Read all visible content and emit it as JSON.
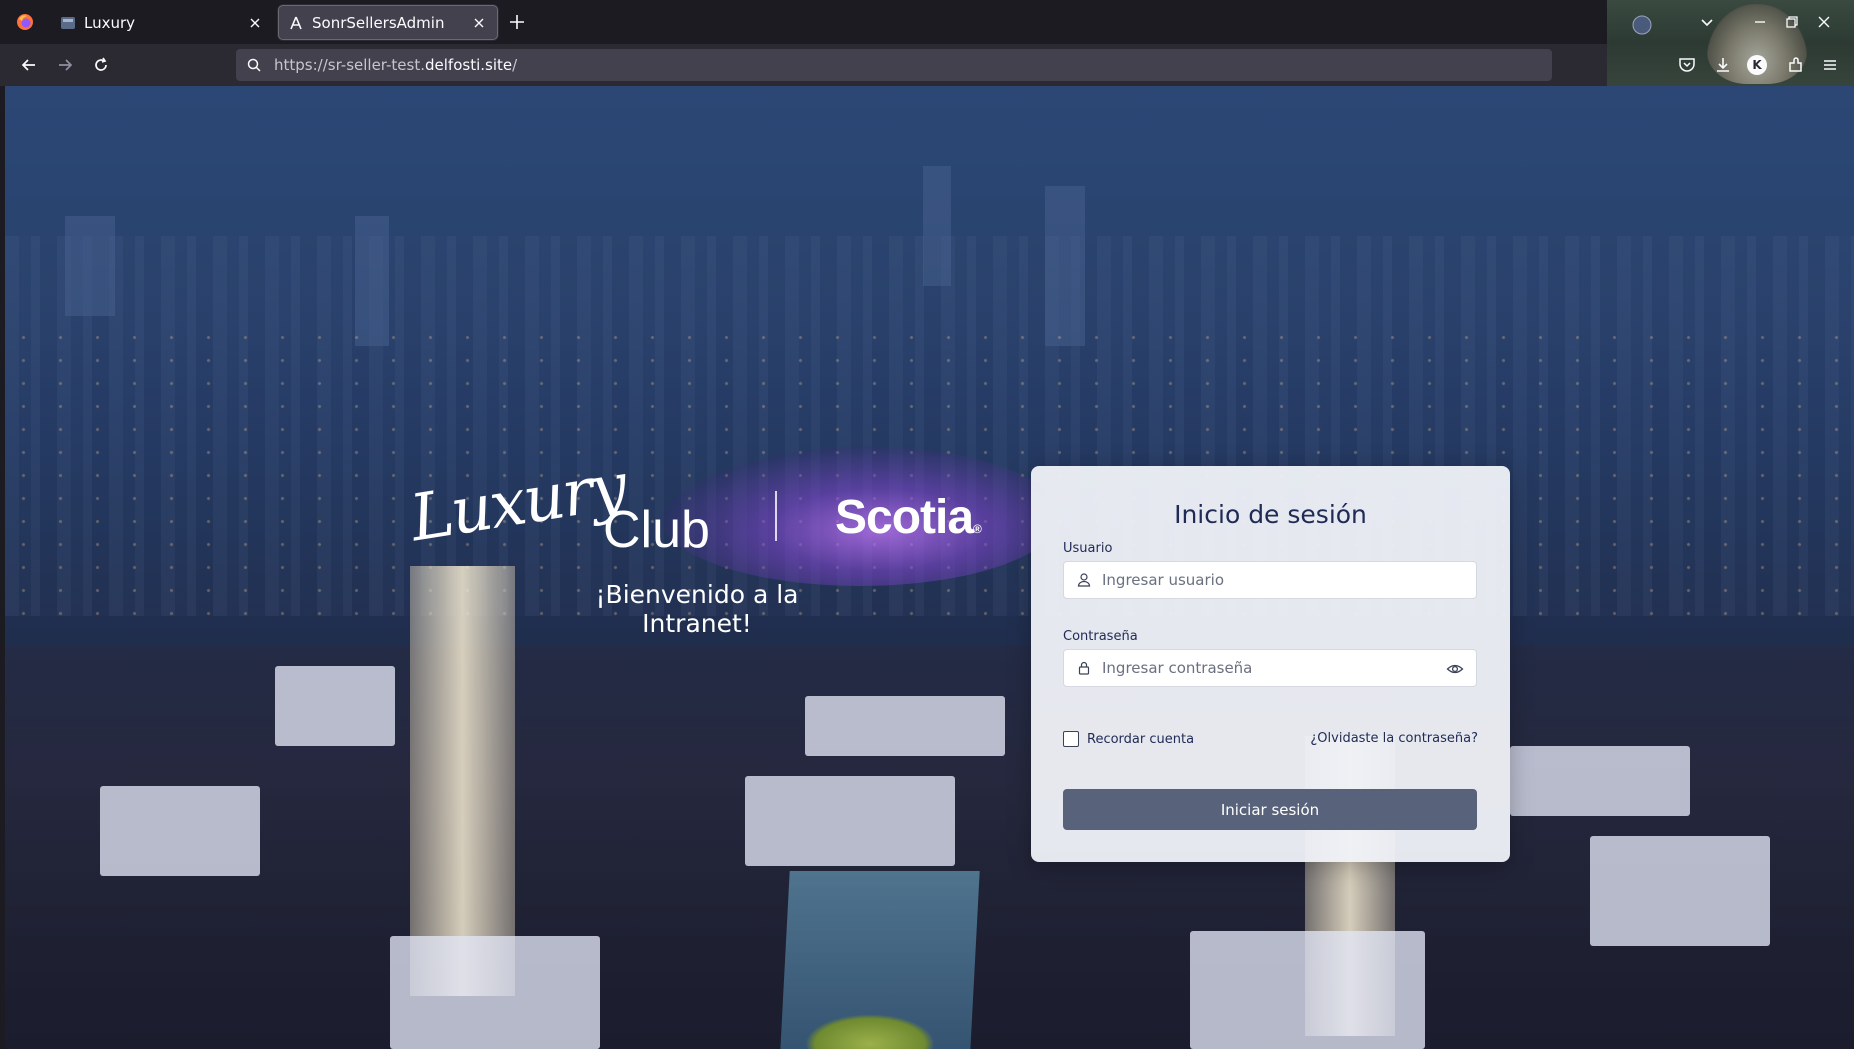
{
  "browser": {
    "tabs": [
      {
        "title": "Luxury",
        "active": false
      },
      {
        "title": "SonrSellersAdmin",
        "active": true
      }
    ],
    "url_prefix": "https://sr-seller-test.",
    "url_host": "delfosti.site",
    "url_suffix": "/",
    "profile_initial": "K",
    "icons": [
      "firefox-logo",
      "back-arrow",
      "forward-arrow",
      "reload",
      "search",
      "pocket",
      "downloads",
      "extensions",
      "menu"
    ]
  },
  "branding": {
    "luxury_script": "Luxury",
    "club": "Club",
    "scotia": "Scotia",
    "scotia_mark": "®",
    "welcome": "¡Bienvenido a la Intranet!"
  },
  "login": {
    "title": "Inicio de sesión",
    "username_label": "Usuario",
    "username_placeholder": "Ingresar usuario",
    "password_label": "Contraseña",
    "password_placeholder": "Ingresar contraseña",
    "remember_label": "Recordar cuenta",
    "forgot_link": "¿Olvidaste la contraseña?",
    "submit_label": "Iniciar sesión"
  },
  "colors": {
    "card_bg": "#f0f2f8",
    "title": "#1f2a55",
    "button": "#58627a"
  }
}
